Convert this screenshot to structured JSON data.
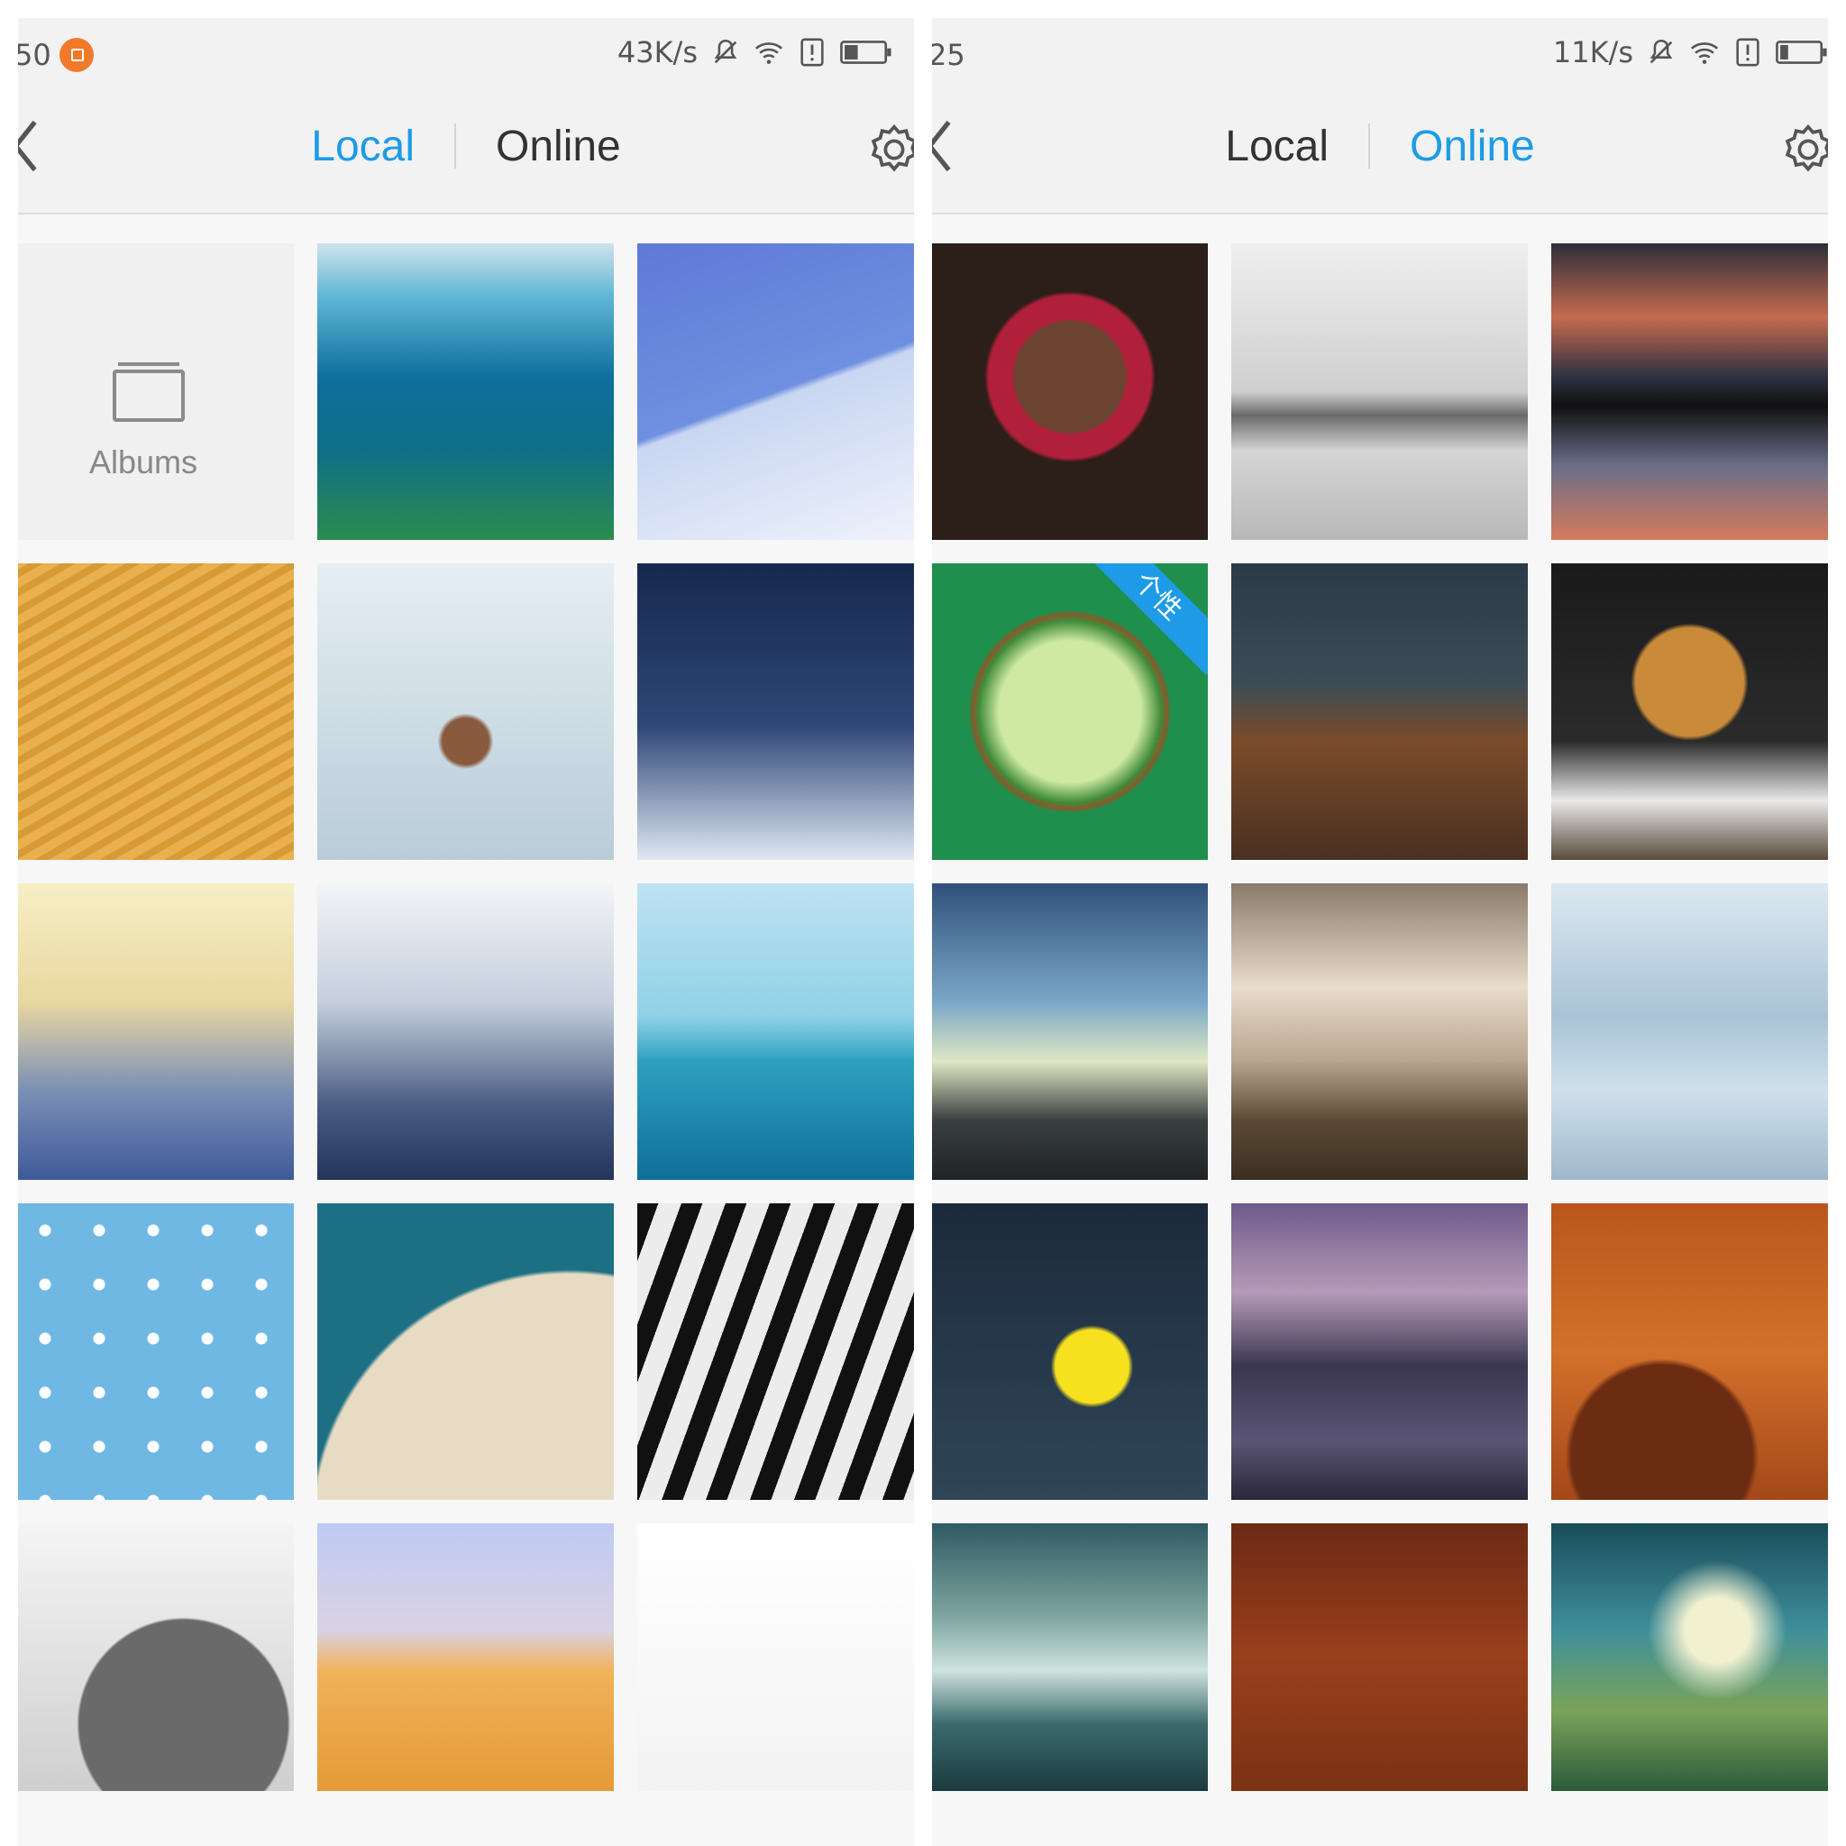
{
  "left": {
    "status": {
      "time": "50",
      "speed": "43K/s"
    },
    "tabs": {
      "local": "Local",
      "online": "Online",
      "active": "local"
    },
    "albums_label": "Albums",
    "tiles": [
      {
        "name": "albums-tile",
        "kind": "albums"
      },
      {
        "name": "ocean-wave",
        "bg": "linear-gradient(180deg,#cfe3ea 0%,#5fb6d6 18%,#0f6f9e 45%,#0f6f86 70%,#2b8c4f 100%)"
      },
      {
        "name": "snow-slope-skier",
        "bg": "linear-gradient(160deg,#5f79d8 0%,#6f90e0 50%,#c9d6f2 52%,#eef2fb 100%)"
      },
      {
        "name": "golden-field-harvester",
        "bg": "repeating-linear-gradient(-30deg,#e9b04f 0 10px,#d89a34 10px 18px)"
      },
      {
        "name": "deer-in-frost",
        "bg": "radial-gradient(circle at 50% 60%,#8a5a3f 0 10%,transparent 12%), linear-gradient(180deg,#e5eef3,#b9ccd8)"
      },
      {
        "name": "mountain-peak-dusk",
        "bg": "linear-gradient(180deg,#16294f 0%,#2e4777 55%,#dfe7f2 100%)"
      },
      {
        "name": "misty-hills",
        "bg": "linear-gradient(180deg,#f6efc4 0%,#e9d7a1 40%,#7b8fb5 70%,#3e5a9a 100%)"
      },
      {
        "name": "sea-waves-mono",
        "bg": "linear-gradient(180deg,#f3f5f8 0%,#c5cfdd 40%,#4a5c82 75%,#24345a 100%)"
      },
      {
        "name": "sky-water-horizon",
        "bg": "linear-gradient(180deg,#bfe2f2 0%,#8fd1e6 45%,#2ea0c0 60%,#0f6f98 100%)"
      },
      {
        "name": "flowers-on-blue",
        "bg": "radial-gradient(circle,#ffffff 0 6px,transparent 7px) 0 0/60px 60px, #6fb8e4"
      },
      {
        "name": "sunglasses-on-hat",
        "bg": "radial-gradient(circle at 85% 110%,#e7dcc3 0 62%,transparent 63%), #1d6f84"
      },
      {
        "name": "zebra-closeup",
        "bg": "repeating-linear-gradient(110deg,#111 0 22px,#ececec 22px 46px)"
      },
      {
        "name": "cat-and-butterfly",
        "bg": "radial-gradient(circle at 60% 75%,#6a6a6a 0 40%,transparent 41%), linear-gradient(180deg,#f4f4f4,#cfcfcf)"
      },
      {
        "name": "camels-desert",
        "bg": "linear-gradient(180deg,#bfcaf2 0%,#d9d2e4 40%,#f0b25a 55%,#e59a35 100%)"
      },
      {
        "name": "snowy-branches-birds",
        "bg": "linear-gradient(180deg,#ffffff 0%,#f3f3f3 100%)"
      }
    ]
  },
  "right": {
    "status": {
      "time": "25",
      "speed": "11K/s"
    },
    "tabs": {
      "local": "Local",
      "online": "Online",
      "active": "online"
    },
    "badge": "个性",
    "tiles": [
      {
        "name": "ice-cream-raspberries",
        "bg": "radial-gradient(circle at 50% 45%,#6b4330 0 26%,#b0203b 27% 38%,transparent 40%), #2c1e18"
      },
      {
        "name": "parliament-mono",
        "bg": "linear-gradient(180deg,#efefef 0%,#cfcfcf 50%,#6a6a6a 58%,#d5d5d5 70%,#b8b8b8 100%)"
      },
      {
        "name": "lake-sunset-mountains",
        "bg": "linear-gradient(180deg,#2c2f3b 0%,#c56b4f 25%,#2e3141 45%,#111 55%,#6a6e88 75%,#d47a5c 100%)"
      },
      {
        "name": "forest-theme-badge",
        "bg": "radial-gradient(circle at 50% 50%,#cfe9a2 0 35%,#3f8b3a 45%,#8a5a2a 48%,#1f8f4e 50%)"
      },
      {
        "name": "ship-in-bottle-books",
        "bg": "linear-gradient(180deg,#2a3b47 0%,#3b4c57 40%,#7a4b2a 60%,#4a3020 100%)"
      },
      {
        "name": "waffles-berries",
        "bg": "radial-gradient(circle at 50% 40%,#c98a3a 0 24%,transparent 26%), linear-gradient(180deg,#1a1a1a 0%,#2b2b2b 60%,#e9e9e9 80%,#5a4b3b 100%)"
      },
      {
        "name": "bike-jump-sky",
        "bg": "linear-gradient(180deg,#30507a 0%,#7aa7c8 40%,#dfe7c3 60%,#3a3f40 80%,#1f2326 100%)"
      },
      {
        "name": "mountain-figure-sunset",
        "bg": "linear-gradient(180deg,#8a7a6a 0%,#e8dccb 35%,#b8a58f 60%,#5b4a35 80%,#3a2e22 100%)"
      },
      {
        "name": "fog-person-water",
        "bg": "linear-gradient(180deg,#dce8f1 0%,#a9c3d6 45%,#cfe0ec 70%,#9fb8cb 100%)"
      },
      {
        "name": "yellow-flower-dark",
        "bg": "radial-gradient(circle at 58% 55%,#f7e11e 0 16%,transparent 18%), linear-gradient(180deg,#1c2a3b,#2f4658)"
      },
      {
        "name": "purple-mountain-lake",
        "bg": "linear-gradient(180deg,#6e5a8a 0%,#b59ab8 30%,#3a3650 55%,#5a5575 80%,#2a2838 100%)"
      },
      {
        "name": "cheetahs-orange",
        "bg": "radial-gradient(circle at 40% 85%,#6b2c12 0 30%,transparent 32%), linear-gradient(180deg,#b9561c 0%,#d3702a 50%,#a3481a 100%)"
      },
      {
        "name": "misty-forest-person",
        "bg": "linear-gradient(180deg,#2f5a63 0%,#7ea5a0 35%,#cfe3df 55%,#3b6a6c 75%,#1c3a40 100%)"
      },
      {
        "name": "zebras-red-earth",
        "bg": "linear-gradient(180deg,#6b2a14 0%,#9a3f1c 50%,#7a3215 100%)"
      },
      {
        "name": "painted-storm-landscape",
        "bg": "radial-gradient(circle at 60% 40%,#f1f1d0 0 14%,transparent 30%), linear-gradient(180deg,#1a4c5a 0%,#3f8f9b 40%,#7aa35a 70%,#2c5b3a 100%)"
      }
    ]
  }
}
